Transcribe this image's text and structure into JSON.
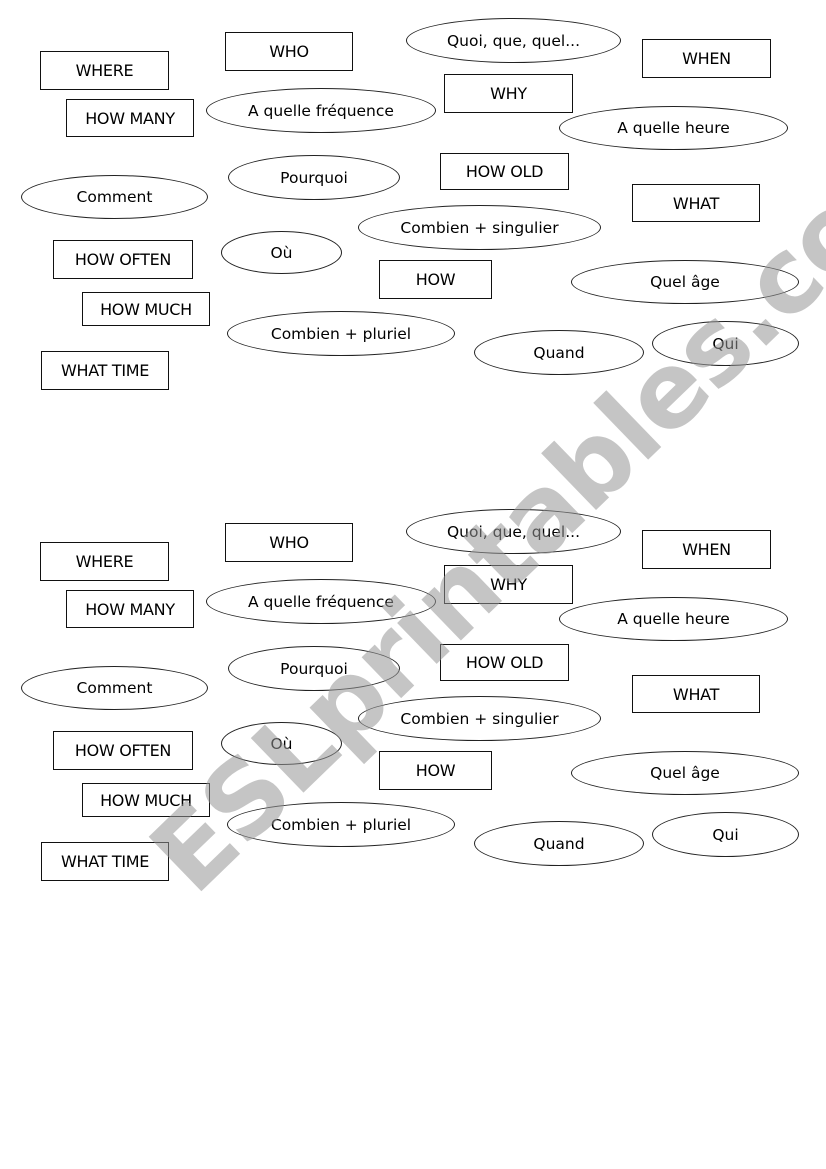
{
  "worksheet": {
    "watermark": "ESLprintables.com",
    "sets": [
      {
        "english_cards": [
          "WHERE",
          "WHO",
          "WHEN",
          "HOW MANY",
          "WHY",
          "HOW OLD",
          "WHAT",
          "HOW OFTEN",
          "HOW",
          "HOW MUCH",
          "WHAT TIME"
        ],
        "french_cards": [
          "Quoi, que, quel...",
          "A quelle fréquence",
          "A quelle heure",
          "Comment",
          "Pourquoi",
          "Combien + singulier",
          "Où",
          "Quel âge",
          "Combien + pluriel",
          "Quand",
          "Qui"
        ]
      },
      {
        "english_cards": [
          "WHERE",
          "WHO",
          "WHEN",
          "HOW MANY",
          "WHY",
          "HOW OLD",
          "WHAT",
          "HOW OFTEN",
          "HOW",
          "HOW MUCH",
          "WHAT TIME"
        ],
        "french_cards": [
          "Quoi, que, quel...",
          "A quelle fréquence",
          "A quelle heure",
          "Comment",
          "Pourquoi",
          "Combien + singulier",
          "Où",
          "Quel âge",
          "Combien + pluriel",
          "Quand",
          "Qui"
        ]
      }
    ]
  }
}
